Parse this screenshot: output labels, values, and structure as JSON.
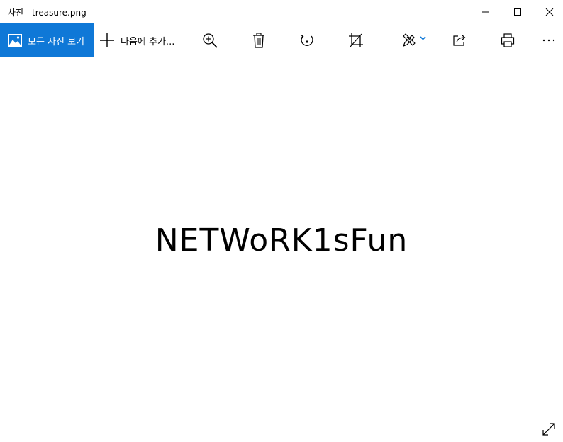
{
  "window": {
    "title": "사진 - treasure.png"
  },
  "toolbar": {
    "all_photos_label": "모든 사진 보기",
    "add_to_label": "다음에 추가..."
  },
  "image": {
    "text": "NETWoRK1sFun"
  },
  "colors": {
    "accent": "#0f78d7",
    "background": "#ffffff"
  }
}
